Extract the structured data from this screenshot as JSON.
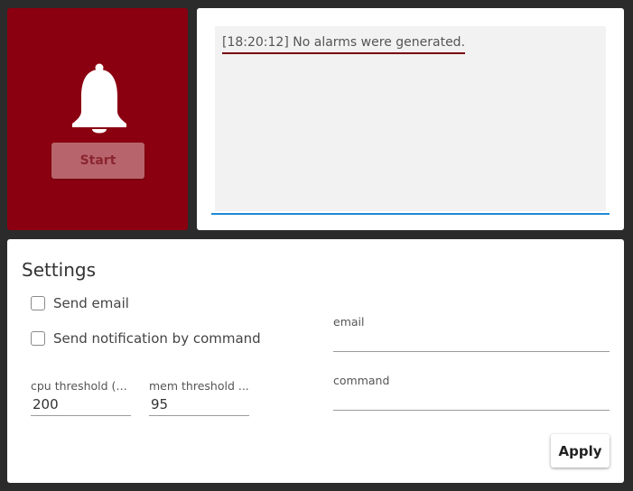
{
  "alarm_panel": {
    "icon": "bell-icon",
    "start_label": "Start",
    "background_color": "#8b0011"
  },
  "log": {
    "entries": [
      "[18:20:12] No alarms were generated."
    ]
  },
  "settings": {
    "title": "Settings",
    "send_email_label": "Send email",
    "send_email_checked": false,
    "send_command_label": "Send notification by command",
    "send_command_checked": false,
    "cpu_threshold": {
      "label": "cpu threshold (%)",
      "value": "200"
    },
    "mem_threshold": {
      "label": "mem threshold ...",
      "value": "95"
    },
    "email": {
      "label": "email",
      "value": ""
    },
    "command": {
      "label": "command",
      "value": ""
    },
    "apply_label": "Apply"
  }
}
